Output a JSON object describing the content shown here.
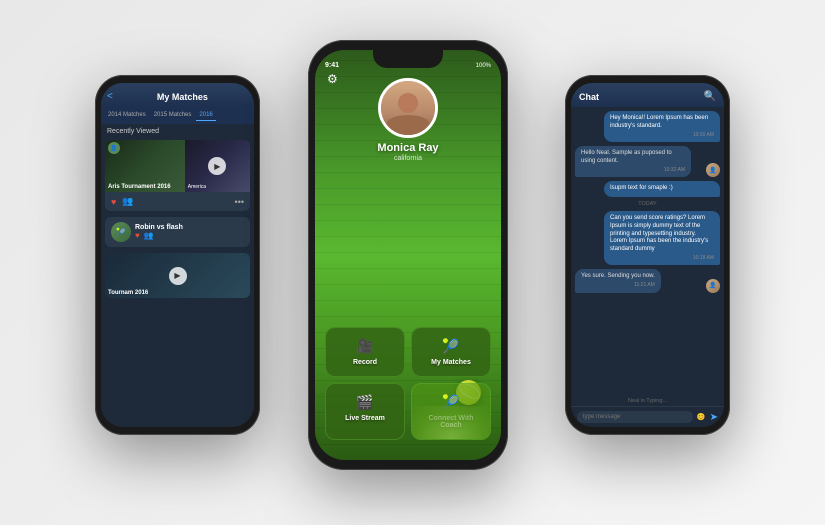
{
  "scene": {
    "background": "#f0f0f0"
  },
  "left_phone": {
    "header": {
      "back_label": "<",
      "title": "My Matches"
    },
    "tabs": [
      {
        "label": "2014 Matches",
        "active": false
      },
      {
        "label": "2015 Matches",
        "active": false
      },
      {
        "label": "2016",
        "active": true
      }
    ],
    "section_title": "Recently Viewed",
    "matches": [
      {
        "title": "Aris Tournament 2016",
        "has_play": true
      },
      {
        "title": "America",
        "has_play": true
      }
    ],
    "robin_card": {
      "title": "Robin vs flash"
    },
    "bottom_card": {
      "title": "Tournam 2016"
    }
  },
  "center_phone": {
    "status_bar": {
      "time": "9:41",
      "battery": "100%"
    },
    "profile": {
      "name": "Monica Ray",
      "location": "california"
    },
    "menu": [
      {
        "id": "record",
        "icon": "🎥",
        "label": "Record"
      },
      {
        "id": "my-matches",
        "icon": "🎾",
        "label": "My Matches"
      },
      {
        "id": "live-stream",
        "icon": "🎬",
        "label": "Live Stream"
      },
      {
        "id": "connect-coach",
        "icon": "🎾",
        "label": "Connect With Coach"
      }
    ]
  },
  "right_phone": {
    "header": {
      "title": "Chat",
      "search_icon": "🔍"
    },
    "messages": [
      {
        "type": "sent",
        "text": "Hey Monica!! Lorem Ipsum has been industry's standard.",
        "time": "10:30 AM"
      },
      {
        "type": "received",
        "text": "Hello Neal. Sample as puposed to using content.",
        "time": "10:32 AM"
      },
      {
        "type": "sent",
        "text": "Isupm text for smaple :)",
        "time": ""
      },
      {
        "type": "divider",
        "text": "TODAY"
      },
      {
        "type": "sent",
        "text": "Can you send score ratings? Lorem Ipsum is simply dummy text of the printing and typesetting industry. Lorem Ipsum has been the industry's standard dummy",
        "time": "10:18 AM"
      },
      {
        "type": "received",
        "text": "Yes sure. Sending you now.",
        "time": "11:21 AM"
      }
    ],
    "typing_indicator": "Neal is Typing...",
    "input_placeholder": "type message"
  }
}
